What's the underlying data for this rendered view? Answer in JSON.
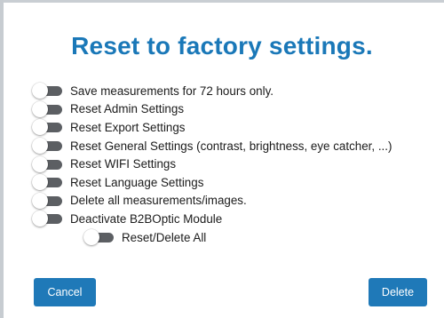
{
  "dialog": {
    "title": "Reset to factory settings."
  },
  "options": [
    {
      "label": "Save measurements for 72 hours only.",
      "checked": false
    },
    {
      "label": "Reset Admin Settings",
      "checked": false
    },
    {
      "label": "Reset Export Settings",
      "checked": false
    },
    {
      "label": "Reset General Settings (contrast, brightness, eye catcher, ...)",
      "checked": false
    },
    {
      "label": "Reset WIFI Settings",
      "checked": false
    },
    {
      "label": "Reset Language Settings",
      "checked": false
    },
    {
      "label": "Delete all measurements/images.",
      "checked": false
    },
    {
      "label": "Deactivate B2BOptic Module",
      "checked": false
    }
  ],
  "master_option": {
    "label": "Reset/Delete All",
    "checked": false
  },
  "buttons": {
    "cancel_label": "Cancel",
    "delete_label": "Delete"
  },
  "colors": {
    "title": "#1a78b8",
    "button": "#1f79b8",
    "toggle_track_off": "#5c5f63"
  }
}
